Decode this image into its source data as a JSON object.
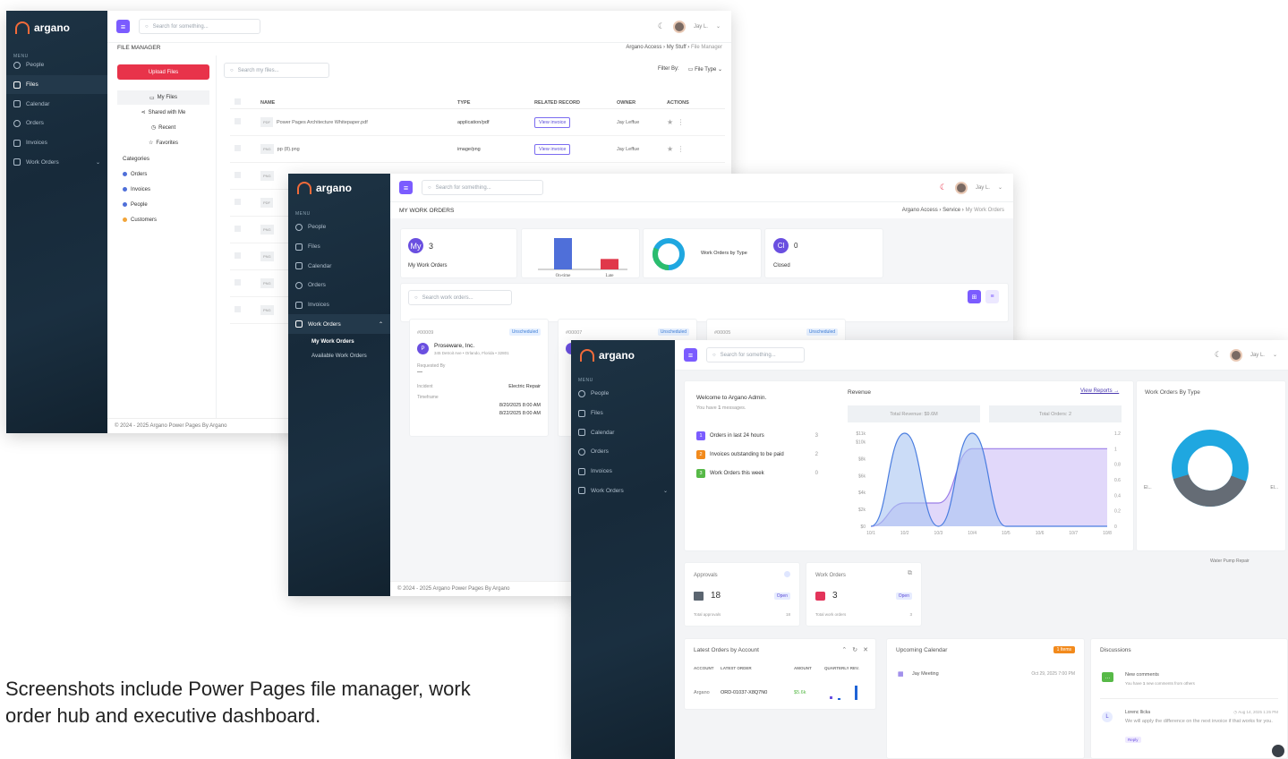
{
  "brand": {
    "name": "argano"
  },
  "common": {
    "menu_label": "MENU",
    "search_placeholder": "Search for something...",
    "user": "Jay L.",
    "footer": "© 2024 - 2025 Argano Power Pages By Argano"
  },
  "win1": {
    "nav": [
      "People",
      "Files",
      "Calendar",
      "Orders",
      "Invoices",
      "Work Orders"
    ],
    "page_title": "FILE MANAGER",
    "breadcrumb": {
      "a": "Argano Access",
      "b": "My Stuff",
      "c": "File Manager"
    },
    "upload_label": "Upload Files",
    "folders": [
      "My Files",
      "Shared with Me",
      "Recent",
      "Favorites"
    ],
    "categories_label": "Categories",
    "categories": [
      "Orders",
      "Invoices",
      "People",
      "Customers"
    ],
    "file_search_placeholder": "Search my files...",
    "filter_label": "Filter By:",
    "filter_value": "File Type",
    "table_headers": [
      "NAME",
      "TYPE",
      "RELATED RECORD",
      "OWNER",
      "ACTIONS"
    ],
    "rows": [
      {
        "badge": "PDF",
        "name": "Power Pages Architecture Whitepaper.pdf",
        "type": "application/pdf",
        "action": "View invoice",
        "owner": "Jay Leffue"
      },
      {
        "badge": "PNG",
        "name": "pp (8).png",
        "type": "image/png",
        "action": "View invoice",
        "owner": "Jay Leffue"
      }
    ],
    "extra_badges": [
      "PNG",
      "PDF",
      "PNG",
      "PNG",
      "PNG",
      "PNG"
    ]
  },
  "win2": {
    "nav": [
      "People",
      "Files",
      "Calendar",
      "Orders",
      "Invoices",
      "Work Orders"
    ],
    "subnav": [
      "My Work Orders",
      "Available Work Orders"
    ],
    "page_title": "MY WORK ORDERS",
    "breadcrumb": {
      "a": "Argano Access",
      "b": "Service",
      "c": "My Work Orders"
    },
    "stat_my": {
      "badge": "My",
      "value": "3",
      "label": "My Work Orders"
    },
    "stat_closed": {
      "badge": "Cl",
      "value": "0",
      "label": "Closed"
    },
    "type_label": "Work Orders by Type",
    "chart_data": {
      "type": "bar",
      "categories": [
        "On-time",
        "Late"
      ],
      "values": [
        3,
        1
      ],
      "colors": [
        "#4f6fd9",
        "#e0384a"
      ]
    },
    "search_placeholder": "Search work orders...",
    "cards": [
      {
        "id": "#00009",
        "status": "Unscheduled",
        "company": "Proseware, Inc.",
        "address": "345 Detroit Ave • Orlando, Florida • 32801",
        "requested_by_label": "Requested By",
        "requested_by": "—",
        "incident_label": "Incident",
        "incident": "Electric Repair",
        "timeframe_label": "Timeframe",
        "start": "8/20/2025 8:00 AM",
        "end": "8/22/2025 8:00 AM"
      },
      {
        "id": "#00007",
        "status": "Unscheduled"
      },
      {
        "id": "#00005",
        "status": "Unscheduled"
      }
    ]
  },
  "win3": {
    "nav": [
      "People",
      "Files",
      "Calendar",
      "Orders",
      "Invoices",
      "Work Orders"
    ],
    "welcome": "Welcome to Argano Admin.",
    "messages_pre": "You have ",
    "messages_count": "1",
    "messages_post": " messages.",
    "tasks": [
      {
        "num": "1",
        "label": "Orders in last 24 hours",
        "count": "3",
        "color": "#7b5cff"
      },
      {
        "num": "2",
        "label": "Invoices outstanding to be paid",
        "count": "2",
        "color": "#f28a1c"
      },
      {
        "num": "3",
        "label": "Work Orders this week",
        "count": "0",
        "color": "#57b947"
      }
    ],
    "revenue_title": "Revenue",
    "view_reports": "View Reports →",
    "total_revenue": "Total Revenue: $9.6M",
    "total_orders": "Total Orders: 2",
    "donut_title": "Work Orders By Type",
    "donut_labels": {
      "left": "El...",
      "right": "El...",
      "bottom": "Water Pump Repair"
    },
    "chart_data": {
      "type": "area",
      "x": [
        "10/1",
        "10/2",
        "10/3",
        "10/4",
        "10/5",
        "10/6",
        "10/7",
        "10/8"
      ],
      "y_left_ticks": [
        "$0",
        "$2k",
        "$4k",
        "$6k",
        "$8k",
        "$10k",
        "$11k"
      ],
      "y_right_ticks": [
        "0",
        "0.2",
        "0.4",
        "0.6",
        "0.8",
        "1",
        "1.2"
      ],
      "series": [
        {
          "values": [
            0,
            11000,
            0,
            11000,
            0,
            0,
            0,
            0
          ],
          "color": "#4a7de0"
        },
        {
          "values": [
            0,
            0.3,
            0.3,
            1,
            1,
            1,
            1,
            1
          ],
          "color": "#9b7de8"
        }
      ]
    },
    "approvals": {
      "title": "Approvals",
      "value": "18",
      "status": "Open",
      "total_label": "Total approvals",
      "total": "18"
    },
    "work_orders": {
      "title": "Work Orders",
      "value": "3",
      "status": "Open",
      "total_label": "Total work orders",
      "total": "3"
    },
    "latest": {
      "title": "Latest Orders by Account",
      "headers": [
        "ACCOUNT",
        "LATEST ORDER",
        "AMOUNT",
        "QUARTERLY REV."
      ],
      "row": {
        "account": "Argano",
        "order": "ORD-01037-X8Q7N0",
        "amount": "$5.6k"
      }
    },
    "calendar": {
      "title": "Upcoming Calendar",
      "badge": "1 Items",
      "event": "Jay Meeting",
      "date": "Oct 29, 2025 7:00 PM"
    },
    "discussions": {
      "title": "Discussions",
      "new_title": "New comments",
      "new_pre": "You have ",
      "new_count": "1",
      "new_post": " new comments from others",
      "author_initial": "L",
      "author": "Lorenc Ilicka",
      "date": "Aug 14, 2025 1:25 PM",
      "text": "We will apply the difference on the next invoice if that works for you.",
      "reply": "Reply"
    }
  },
  "caption": "Screenshots include Power Pages file manager, work order hub and executive dashboard."
}
